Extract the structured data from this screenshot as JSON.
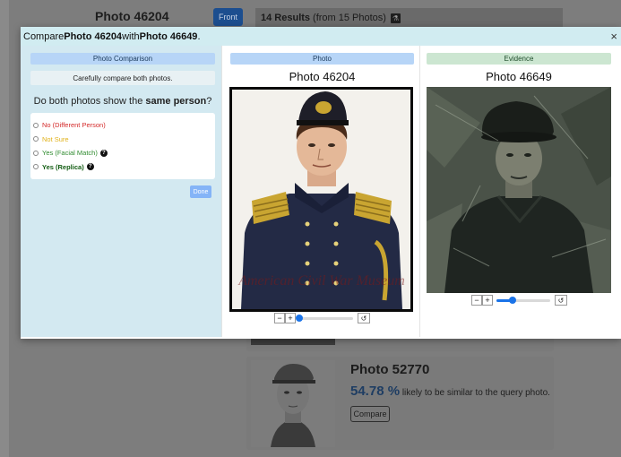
{
  "background": {
    "photo_title": "Photo 46204",
    "front_button": "Front",
    "results_count": "14 Results",
    "results_from": "(from 15 Photos)",
    "flask_icon": "flask-icon",
    "card": {
      "title": "Photo 52770",
      "similarity_pct": "54.78 %",
      "similarity_text": "likely to be similar to the query photo.",
      "compare_button": "Compare"
    }
  },
  "modal": {
    "header_prefix": "Compare ",
    "header_photo_a": "Photo 46204",
    "header_mid": " with ",
    "header_photo_b": "Photo 46649",
    "header_suffix": ".",
    "close": "×",
    "comparison": {
      "tag": "Photo Comparison",
      "instruction": "Carefully compare both photos.",
      "question_prefix": "Do both photos show the ",
      "question_bold": "same person",
      "question_suffix": "?",
      "options": [
        {
          "label": "No (Different Person)",
          "selected": false
        },
        {
          "label": "Not Sure",
          "selected": false
        },
        {
          "label": "Yes (Facial Match)",
          "selected": false,
          "help": "?"
        },
        {
          "label": "Yes (Replica)",
          "selected": false,
          "help": "?"
        }
      ],
      "done_button": "Done"
    },
    "photo": {
      "tag": "Photo",
      "title": "Photo 46204",
      "watermark": "American Civil War Museum",
      "zoom_level": 0,
      "minus": "−",
      "plus": "+",
      "reset": "↺"
    },
    "evidence": {
      "tag": "Evidence",
      "title": "Photo 46649",
      "zoom_level": 0.3,
      "minus": "−",
      "plus": "+",
      "reset": "↺"
    }
  },
  "colors": {
    "header_bg": "#d1ecf1",
    "photo_tag": "#b7d5f7",
    "evidence_tag": "#cce6d1",
    "slider": "#1a73e8",
    "no_option": "#d42a2a",
    "not_sure_option": "#e1b21b",
    "facial_match_option": "#2f8b2f",
    "replica_option": "#155e15"
  }
}
